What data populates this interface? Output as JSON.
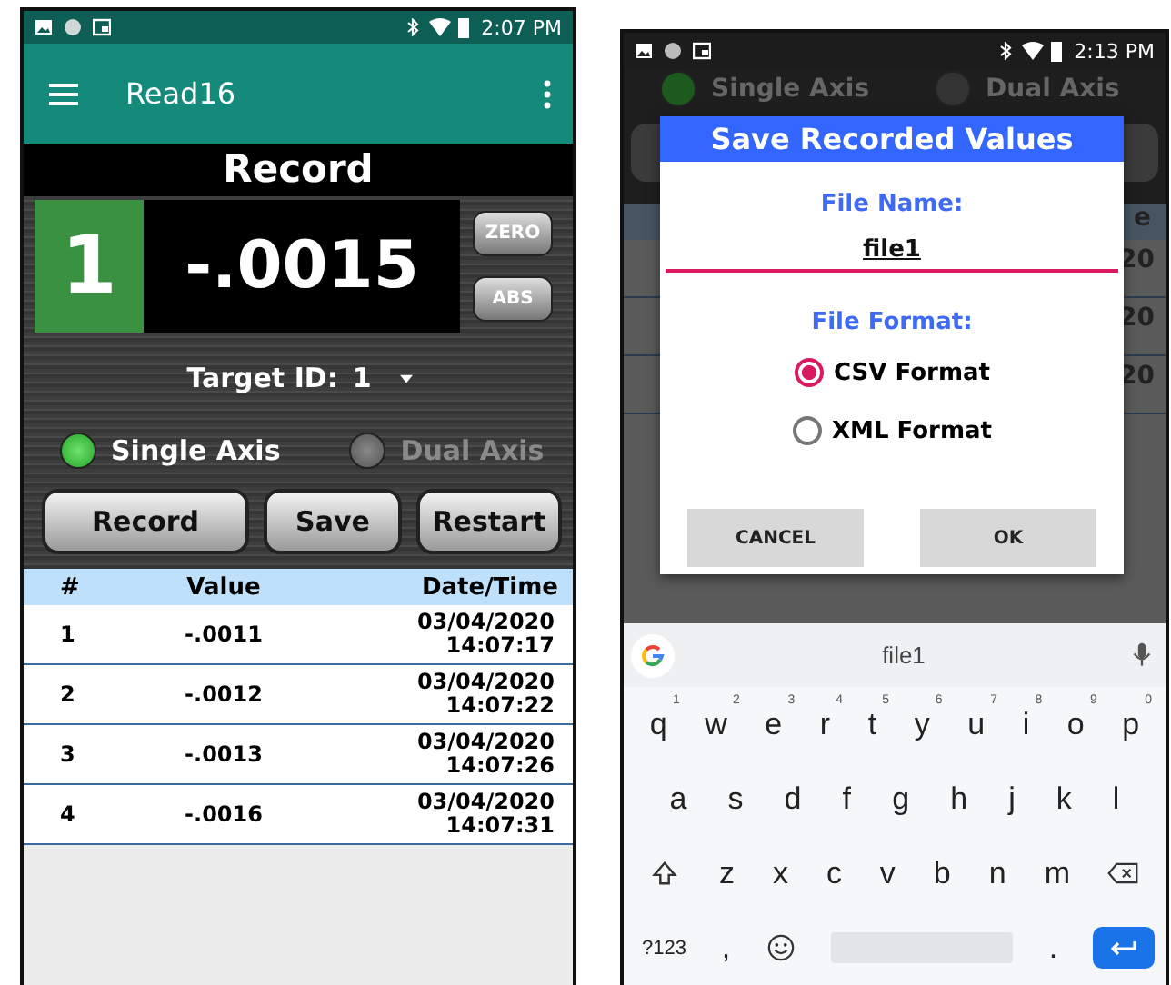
{
  "record_screen": {
    "status_bar": {
      "time": "2:07 PM"
    },
    "app_bar": {
      "title": "Read16"
    },
    "page_title": "Record",
    "display": {
      "channel": "1",
      "value": "-.0015",
      "buttons": [
        "ZERO",
        "ABS"
      ]
    },
    "target": {
      "label": "Target ID:",
      "value": "1"
    },
    "axis_options": [
      {
        "label": "Single Axis",
        "selected": true
      },
      {
        "label": "Dual Axis",
        "selected": false
      }
    ],
    "buttons": [
      "Record",
      "Save",
      "Restart"
    ],
    "table": {
      "columns": [
        "#",
        "Value",
        "Date/Time"
      ],
      "rows": [
        {
          "number": "1",
          "value": "-.0011",
          "date": "03/04/2020",
          "time": "14:07:17"
        },
        {
          "number": "2",
          "value": "-.0012",
          "date": "03/04/2020",
          "time": "14:07:22"
        },
        {
          "number": "3",
          "value": "-.0013",
          "date": "03/04/2020",
          "time": "14:07:26"
        },
        {
          "number": "4",
          "value": "-.0016",
          "date": "03/04/2020",
          "time": "14:07:31"
        }
      ]
    }
  },
  "save_screen": {
    "status_bar": {
      "time": "2:13 PM"
    },
    "axis_options": [
      {
        "label": "Single Axis",
        "selected": true
      },
      {
        "label": "Dual Axis",
        "selected": false
      }
    ],
    "table_fragments": {
      "header": "e",
      "cells": [
        "20",
        "20",
        "20"
      ]
    },
    "dialog": {
      "title": "Save Recorded Values",
      "file_name_label": "File Name:",
      "file_name": "file1",
      "format_label": "File Format:",
      "formats": [
        {
          "label": "CSV Format",
          "selected": true
        },
        {
          "label": "XML Format",
          "selected": false
        }
      ],
      "buttons": [
        "CANCEL",
        "OK"
      ]
    },
    "keyboard": {
      "suggestion": "file1",
      "row_1": [
        {
          "key": "q",
          "hint": "1"
        },
        {
          "key": "w",
          "hint": "2"
        },
        {
          "key": "e",
          "hint": "3"
        },
        {
          "key": "r",
          "hint": "4"
        },
        {
          "key": "t",
          "hint": "5"
        },
        {
          "key": "y",
          "hint": "6"
        },
        {
          "key": "u",
          "hint": "7"
        },
        {
          "key": "i",
          "hint": "8"
        },
        {
          "key": "o",
          "hint": "9"
        },
        {
          "key": "p",
          "hint": "0"
        }
      ],
      "row_2": [
        "a",
        "s",
        "d",
        "f",
        "g",
        "h",
        "j",
        "k",
        "l"
      ],
      "row_3": [
        "z",
        "x",
        "c",
        "v",
        "b",
        "n",
        "m"
      ],
      "symbols_key": "?123",
      "comma_key": ",",
      "period_key": "."
    }
  }
}
